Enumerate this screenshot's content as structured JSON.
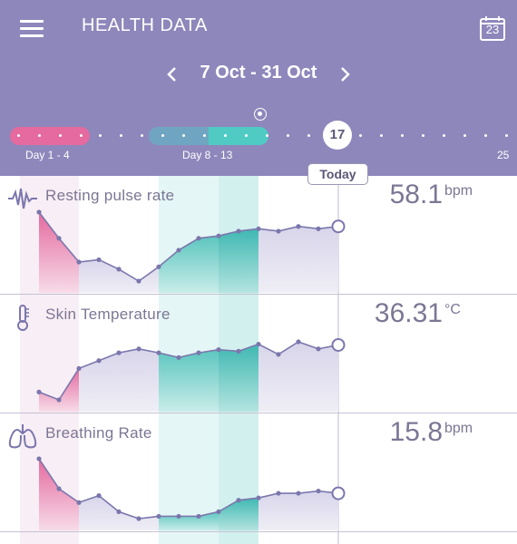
{
  "header": {
    "title": "HEALTH DATA",
    "calendar_day": "23",
    "date_range": "7 Oct - 31 Oct",
    "timeline": {
      "period_label": "Day 1 - 4",
      "fertile_label": "Day 8 - 13",
      "today_day": "17",
      "end_day": "25",
      "today_badge": "Today"
    }
  },
  "colors": {
    "header_bg": "#8e87bb",
    "period": "#e46a9f",
    "fertile": "#54c5c0",
    "line": "#7b77ad"
  },
  "metrics": [
    {
      "name": "Resting pulse rate",
      "icon": "pulse-icon",
      "value": "58.1",
      "unit": "bpm",
      "series": [
        60.2,
        59.1,
        58.1,
        58.2,
        57.8,
        57.3,
        57.9,
        58.6,
        59.1,
        59.2,
        59.4,
        59.5,
        59.4,
        59.6,
        59.5,
        59.6
      ]
    },
    {
      "name": "Skin Temperature",
      "icon": "thermometer-icon",
      "value": "36.31",
      "unit": "°C",
      "series": [
        35.8,
        35.7,
        36.1,
        36.2,
        36.3,
        36.35,
        36.3,
        36.24,
        36.3,
        36.34,
        36.32,
        36.41,
        36.28,
        36.44,
        36.35,
        36.4
      ]
    },
    {
      "name": "Breathing Rate",
      "icon": "lungs-icon",
      "value": "15.8",
      "unit": "bpm",
      "series": [
        18.3,
        17.0,
        16.4,
        16.7,
        16.0,
        15.7,
        15.8,
        15.8,
        15.8,
        16.0,
        16.5,
        16.6,
        16.8,
        16.8,
        16.9,
        16.8
      ]
    }
  ]
}
